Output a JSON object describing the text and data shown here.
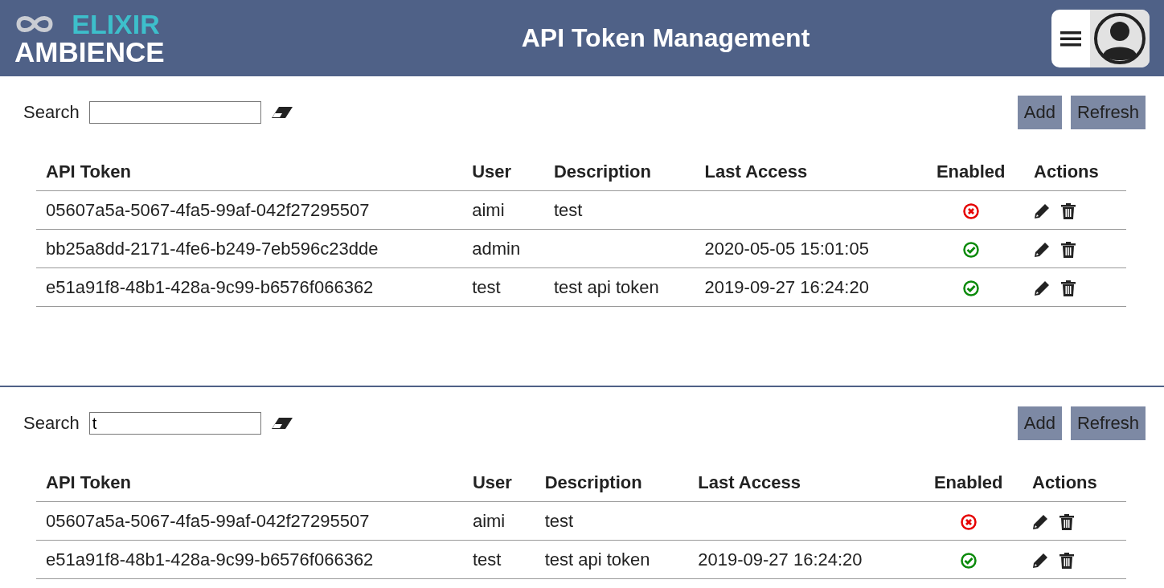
{
  "header": {
    "logo_top": "ELIXIR",
    "logo_bottom": "AMBIENCE",
    "title": "API Token Management"
  },
  "panels": [
    {
      "search": {
        "label": "Search"
      },
      "buttons": [
        "Add",
        "Refresh"
      ],
      "columns": [
        "API Token",
        "User",
        "Description",
        "Last Access",
        "Enabled",
        "Actions"
      ],
      "rows": [
        {
          "token": "05607a5a-5067-4fa5-99af-042f27295507",
          "user": "aimi",
          "description": "test",
          "last_access": "",
          "enabled": false
        },
        {
          "token": "bb25a8dd-2171-4fe6-b249-7eb596c23dde",
          "user": "admin",
          "description": "",
          "last_access": "2020-05-05 15:01:05",
          "enabled": true
        },
        {
          "token": "e51a91f8-48b1-428a-9c99-b6576f066362",
          "user": "test",
          "description": "test api token",
          "last_access": "2019-09-27 16:24:20",
          "enabled": true
        }
      ]
    },
    {
      "search": {
        "label": "Search",
        "value": "t"
      },
      "buttons": [
        "Add",
        "Refresh"
      ],
      "columns": [
        "API Token",
        "User",
        "Description",
        "Last Access",
        "Enabled",
        "Actions"
      ],
      "rows": [
        {
          "token": "05607a5a-5067-4fa5-99af-042f27295507",
          "user": "aimi",
          "description": "test",
          "last_access": "",
          "enabled": false
        },
        {
          "token": "e51a91f8-48b1-428a-9c99-b6576f066362",
          "user": "test",
          "description": "test api token",
          "last_access": "2019-09-27 16:24:20",
          "enabled": true
        }
      ]
    }
  ]
}
